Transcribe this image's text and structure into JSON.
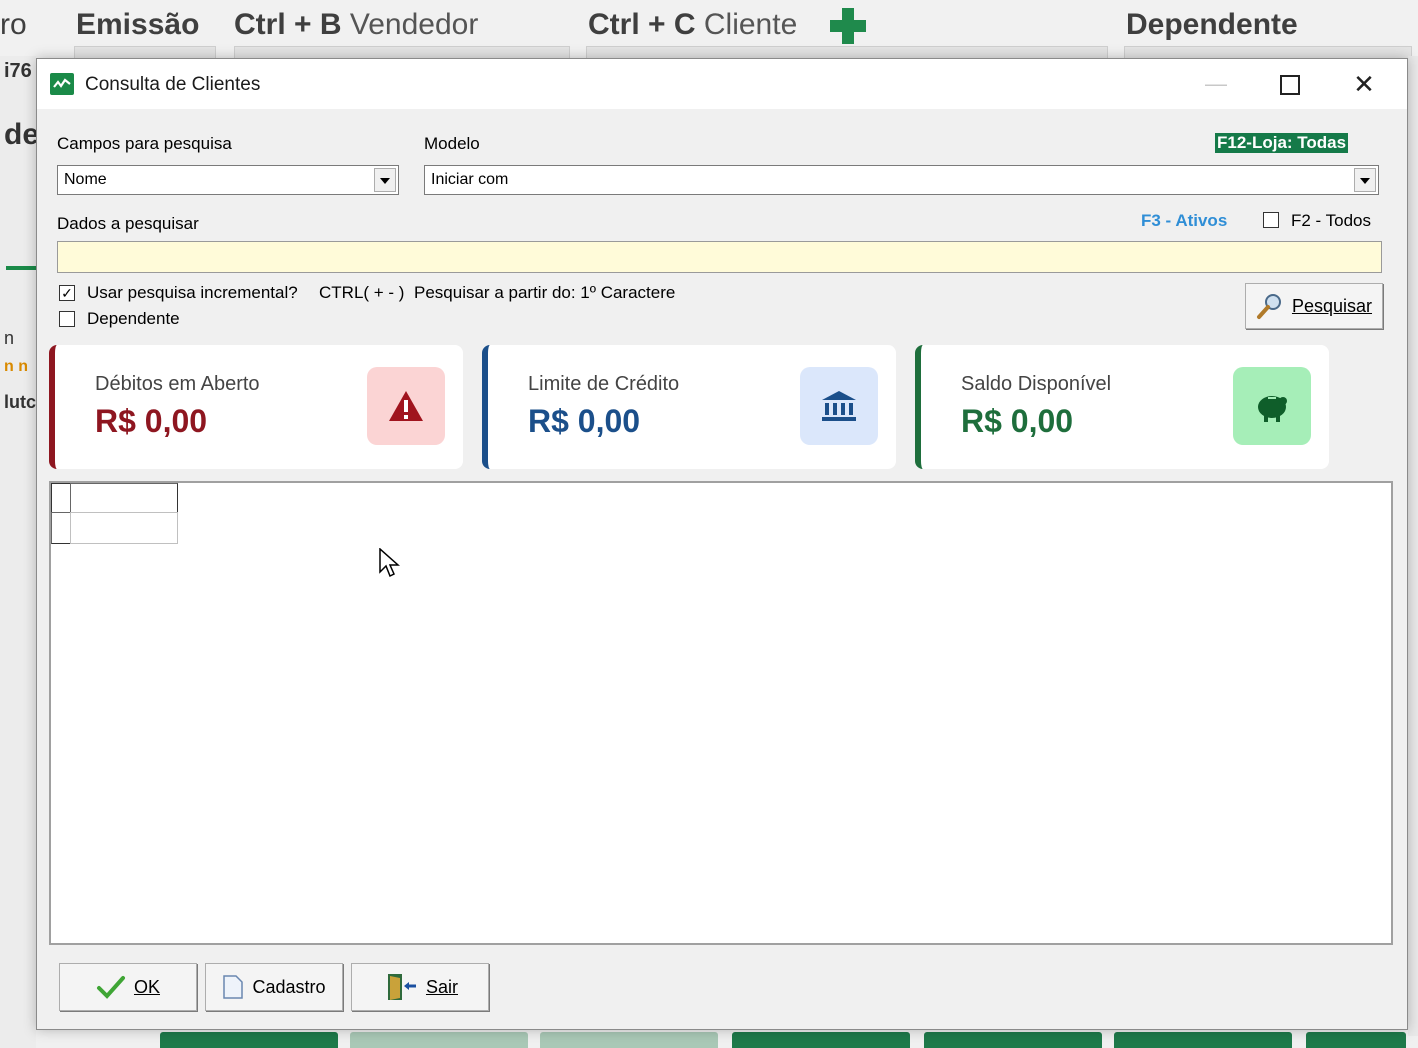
{
  "background_app": {
    "toolbar": {
      "left_fragment": "ro",
      "emissao_label": "Emissão",
      "ctrl_b_key": "Ctrl + B",
      "ctrl_b_label": "Vendedor",
      "ctrl_c_key": "Ctrl + C",
      "ctrl_c_label": "Cliente",
      "dependente_label": "Dependente"
    },
    "left_fragments": [
      "i76",
      "de",
      "n",
      "n n",
      "lutc"
    ]
  },
  "dialog": {
    "title": "Consulta de Clientes",
    "app_icon": "stock-chart-icon",
    "window_controls": {
      "minimize": "minimize-icon",
      "maximize": "maximize-icon",
      "close": "✕"
    },
    "campos_label": "Campos para pesquisa",
    "campos_value": "Nome",
    "modelo_label": "Modelo",
    "modelo_value": "Iniciar com",
    "loja_badge": "F12-Loja: Todas",
    "dados_label": "Dados a pesquisar",
    "f3_label": "F3 - Ativos",
    "f2_label": "F2 - Todos",
    "f2_checked": false,
    "search_value": "",
    "incremental_label": "Usar pesquisa incremental?",
    "incremental_checked": true,
    "ctrl_hint": "CTRL( + - )",
    "pesquisar_partir": "Pesquisar a partir do: 1º Caractere",
    "dependente_label": "Dependente",
    "dependente_checked": false,
    "pesquisar_button": "Pesquisar",
    "cards": [
      {
        "label": "Débitos em Aberto",
        "value": "R$ 0,00",
        "color": "#8e1620",
        "icon": "warning-icon",
        "icon_bg": "#fbd4d4"
      },
      {
        "label": "Limite de Crédito",
        "value": "R$ 0,00",
        "color": "#1b4f8a",
        "icon": "bank-icon",
        "icon_bg": "#dbe7fb"
      },
      {
        "label": "Saldo Disponível",
        "value": "R$ 0,00",
        "color": "#1e6e3c",
        "icon": "piggy-bank-icon",
        "icon_bg": "#a6eeb8"
      }
    ],
    "buttons": {
      "ok": "OK",
      "cadastro": "Cadastro",
      "sair": "Sair"
    }
  },
  "colors": {
    "accent_green": "#1a8a48",
    "search_bg": "#fffbd9",
    "f3_blue": "#2f8ed6"
  }
}
